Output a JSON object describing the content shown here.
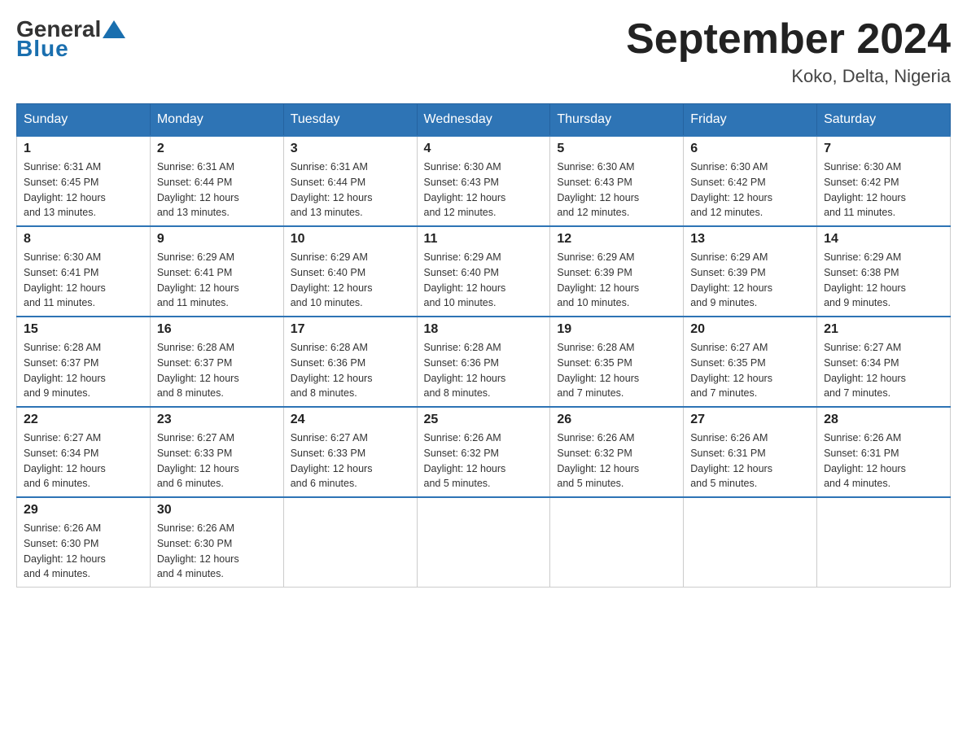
{
  "logo": {
    "general": "General",
    "blue": "Blue"
  },
  "header": {
    "title": "September 2024",
    "subtitle": "Koko, Delta, Nigeria"
  },
  "days": {
    "headers": [
      "Sunday",
      "Monday",
      "Tuesday",
      "Wednesday",
      "Thursday",
      "Friday",
      "Saturday"
    ]
  },
  "weeks": [
    [
      {
        "day": "1",
        "sunrise": "6:31 AM",
        "sunset": "6:45 PM",
        "daylight": "12 hours and 13 minutes."
      },
      {
        "day": "2",
        "sunrise": "6:31 AM",
        "sunset": "6:44 PM",
        "daylight": "12 hours and 13 minutes."
      },
      {
        "day": "3",
        "sunrise": "6:31 AM",
        "sunset": "6:44 PM",
        "daylight": "12 hours and 13 minutes."
      },
      {
        "day": "4",
        "sunrise": "6:30 AM",
        "sunset": "6:43 PM",
        "daylight": "12 hours and 12 minutes."
      },
      {
        "day": "5",
        "sunrise": "6:30 AM",
        "sunset": "6:43 PM",
        "daylight": "12 hours and 12 minutes."
      },
      {
        "day": "6",
        "sunrise": "6:30 AM",
        "sunset": "6:42 PM",
        "daylight": "12 hours and 12 minutes."
      },
      {
        "day": "7",
        "sunrise": "6:30 AM",
        "sunset": "6:42 PM",
        "daylight": "12 hours and 11 minutes."
      }
    ],
    [
      {
        "day": "8",
        "sunrise": "6:30 AM",
        "sunset": "6:41 PM",
        "daylight": "12 hours and 11 minutes."
      },
      {
        "day": "9",
        "sunrise": "6:29 AM",
        "sunset": "6:41 PM",
        "daylight": "12 hours and 11 minutes."
      },
      {
        "day": "10",
        "sunrise": "6:29 AM",
        "sunset": "6:40 PM",
        "daylight": "12 hours and 10 minutes."
      },
      {
        "day": "11",
        "sunrise": "6:29 AM",
        "sunset": "6:40 PM",
        "daylight": "12 hours and 10 minutes."
      },
      {
        "day": "12",
        "sunrise": "6:29 AM",
        "sunset": "6:39 PM",
        "daylight": "12 hours and 10 minutes."
      },
      {
        "day": "13",
        "sunrise": "6:29 AM",
        "sunset": "6:39 PM",
        "daylight": "12 hours and 9 minutes."
      },
      {
        "day": "14",
        "sunrise": "6:29 AM",
        "sunset": "6:38 PM",
        "daylight": "12 hours and 9 minutes."
      }
    ],
    [
      {
        "day": "15",
        "sunrise": "6:28 AM",
        "sunset": "6:37 PM",
        "daylight": "12 hours and 9 minutes."
      },
      {
        "day": "16",
        "sunrise": "6:28 AM",
        "sunset": "6:37 PM",
        "daylight": "12 hours and 8 minutes."
      },
      {
        "day": "17",
        "sunrise": "6:28 AM",
        "sunset": "6:36 PM",
        "daylight": "12 hours and 8 minutes."
      },
      {
        "day": "18",
        "sunrise": "6:28 AM",
        "sunset": "6:36 PM",
        "daylight": "12 hours and 8 minutes."
      },
      {
        "day": "19",
        "sunrise": "6:28 AM",
        "sunset": "6:35 PM",
        "daylight": "12 hours and 7 minutes."
      },
      {
        "day": "20",
        "sunrise": "6:27 AM",
        "sunset": "6:35 PM",
        "daylight": "12 hours and 7 minutes."
      },
      {
        "day": "21",
        "sunrise": "6:27 AM",
        "sunset": "6:34 PM",
        "daylight": "12 hours and 7 minutes."
      }
    ],
    [
      {
        "day": "22",
        "sunrise": "6:27 AM",
        "sunset": "6:34 PM",
        "daylight": "12 hours and 6 minutes."
      },
      {
        "day": "23",
        "sunrise": "6:27 AM",
        "sunset": "6:33 PM",
        "daylight": "12 hours and 6 minutes."
      },
      {
        "day": "24",
        "sunrise": "6:27 AM",
        "sunset": "6:33 PM",
        "daylight": "12 hours and 6 minutes."
      },
      {
        "day": "25",
        "sunrise": "6:26 AM",
        "sunset": "6:32 PM",
        "daylight": "12 hours and 5 minutes."
      },
      {
        "day": "26",
        "sunrise": "6:26 AM",
        "sunset": "6:32 PM",
        "daylight": "12 hours and 5 minutes."
      },
      {
        "day": "27",
        "sunrise": "6:26 AM",
        "sunset": "6:31 PM",
        "daylight": "12 hours and 5 minutes."
      },
      {
        "day": "28",
        "sunrise": "6:26 AM",
        "sunset": "6:31 PM",
        "daylight": "12 hours and 4 minutes."
      }
    ],
    [
      {
        "day": "29",
        "sunrise": "6:26 AM",
        "sunset": "6:30 PM",
        "daylight": "12 hours and 4 minutes."
      },
      {
        "day": "30",
        "sunrise": "6:26 AM",
        "sunset": "6:30 PM",
        "daylight": "12 hours and 4 minutes."
      },
      null,
      null,
      null,
      null,
      null
    ]
  ]
}
